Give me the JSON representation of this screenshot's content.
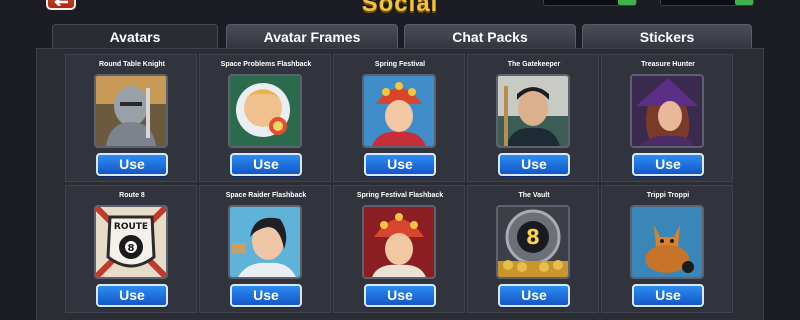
{
  "header": {
    "title": "Social"
  },
  "tabs": [
    {
      "label": "Avatars",
      "active": true
    },
    {
      "label": "Avatar Frames",
      "active": false
    },
    {
      "label": "Chat Packs",
      "active": false
    },
    {
      "label": "Stickers",
      "active": false
    }
  ],
  "items": [
    {
      "name": "Round Table Knight",
      "button": "Use",
      "icon": "knight-avatar"
    },
    {
      "name": "Space Problems Flashback",
      "button": "Use",
      "icon": "astronaut-avatar"
    },
    {
      "name": "Spring Festival",
      "button": "Use",
      "icon": "festival-girl-avatar"
    },
    {
      "name": "The Gatekeeper",
      "button": "Use",
      "icon": "gatekeeper-avatar"
    },
    {
      "name": "Treasure Hunter",
      "button": "Use",
      "icon": "witch-hunter-avatar"
    },
    {
      "name": "Route 8",
      "button": "Use",
      "icon": "route-8-sign-avatar"
    },
    {
      "name": "Space Raider Flashback",
      "button": "Use",
      "icon": "space-raider-avatar"
    },
    {
      "name": "Spring Festival Flashback",
      "button": "Use",
      "icon": "festival-girl-avatar"
    },
    {
      "name": "The Vault",
      "button": "Use",
      "icon": "vault-8-ball-avatar"
    },
    {
      "name": "Trippi Troppi",
      "button": "Use",
      "icon": "cat-fish-avatar"
    }
  ],
  "colors": {
    "accent_button": "#1f6fe0",
    "title": "#f3c33c",
    "panel": "#2b2d35"
  }
}
